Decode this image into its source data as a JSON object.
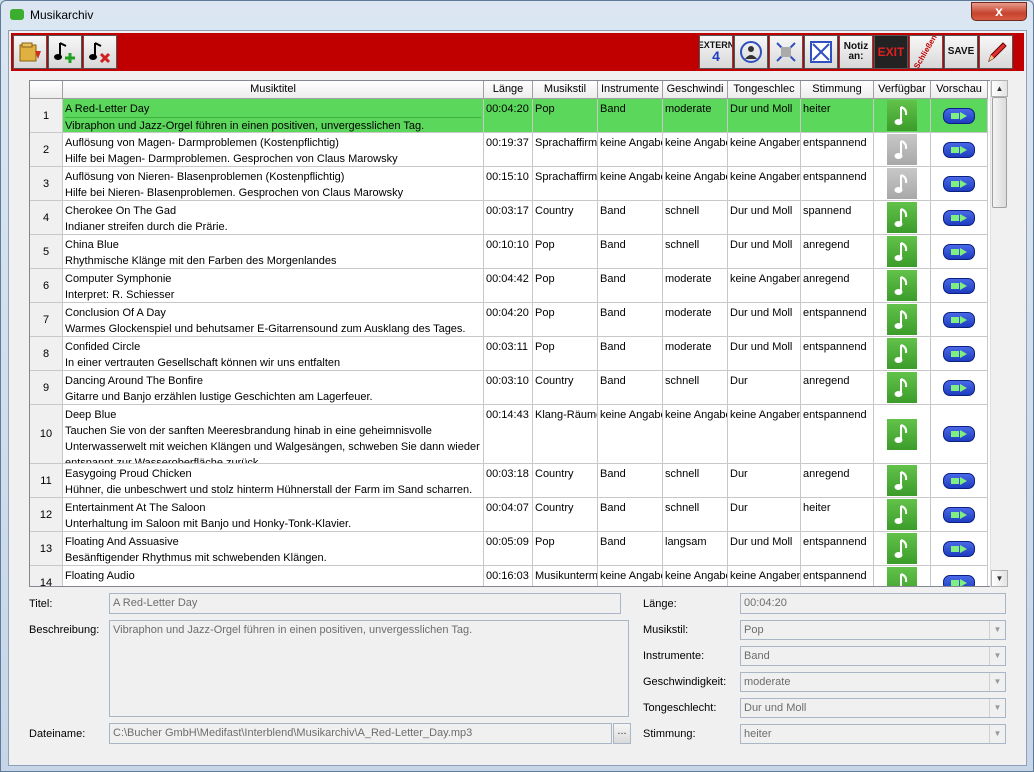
{
  "window": {
    "title": "Musikarchiv",
    "close_glyph": "x"
  },
  "toolbar": {
    "extern_label": "EXTERN",
    "extern_num": "4",
    "notiz_label": "Notiz",
    "notiz_label2": "an:",
    "exit_label": "EXIT",
    "schliessen_label": "Schließen",
    "save_label": "SAVE"
  },
  "table": {
    "columns": [
      "Musiktitel",
      "Länge",
      "Musikstil",
      "Instrumente",
      "Geschwindi",
      "Tongeschlec",
      "Stimmung",
      "Verfügbar",
      "Vorschau"
    ],
    "rows": [
      {
        "num": "1",
        "title": "A Red-Letter Day",
        "desc": "Vibraphon und Jazz-Orgel führen in einen positiven, unvergesslichen Tag.",
        "length": "00:04:20",
        "style": "Pop",
        "instr": "Band",
        "speed": "moderate",
        "tone": "Dur und Moll",
        "mood": "heiter",
        "available": true,
        "selected": true
      },
      {
        "num": "2",
        "title": "Auflösung von Magen- Darmproblemen (Kostenpflichtig)",
        "desc": "Hilfe bei Magen- Darmproblemen. Gesprochen von Claus Marowsky",
        "length": "00:19:37",
        "style": "Sprachaffirma",
        "instr": "keine Angabe",
        "speed": "keine Angabe",
        "tone": "keine Angaben",
        "mood": "entspannend",
        "available": false
      },
      {
        "num": "3",
        "title": "Auflösung von Nieren- Blasenproblemen (Kostenpflichtig)",
        "desc": "Hilfe bei Nieren- Blasenproblemen. Gesprochen von Claus Marowsky",
        "length": "00:15:10",
        "style": "Sprachaffirma",
        "instr": "keine Angabe",
        "speed": "keine Angabe",
        "tone": "keine Angaben",
        "mood": "entspannend",
        "available": false
      },
      {
        "num": "4",
        "title": "Cherokee On The Gad",
        "desc": "Indianer streifen durch die Prärie.",
        "length": "00:03:17",
        "style": "Country",
        "instr": "Band",
        "speed": "schnell",
        "tone": "Dur und Moll",
        "mood": "spannend",
        "available": true
      },
      {
        "num": "5",
        "title": "China Blue",
        "desc": "Rhythmische Klänge mit den Farben des Morgenlandes",
        "length": "00:10:10",
        "style": "Pop",
        "instr": "Band",
        "speed": "schnell",
        "tone": "Dur und Moll",
        "mood": "anregend",
        "available": true
      },
      {
        "num": "6",
        "title": "Computer Symphonie",
        "desc": "Interpret: R. Schiesser",
        "length": "00:04:42",
        "style": "Pop",
        "instr": "Band",
        "speed": "moderate",
        "tone": "keine Angaben",
        "mood": "anregend",
        "available": true
      },
      {
        "num": "7",
        "title": "Conclusion Of A Day",
        "desc": "Warmes Glockenspiel und behutsamer E-Gitarrensound zum Ausklang des Tages.",
        "length": "00:04:20",
        "style": "Pop",
        "instr": "Band",
        "speed": "moderate",
        "tone": "Dur und Moll",
        "mood": "entspannend",
        "available": true
      },
      {
        "num": "8",
        "title": "Confided Circle",
        "desc": "In einer vertrauten Gesellschaft können wir uns entfalten",
        "length": "00:03:11",
        "style": "Pop",
        "instr": "Band",
        "speed": "moderate",
        "tone": "Dur und Moll",
        "mood": "entspannend",
        "available": true
      },
      {
        "num": "9",
        "title": "Dancing Around The Bonfire",
        "desc": "Gitarre und Banjo erzählen lustige Geschichten am Lagerfeuer.",
        "length": "00:03:10",
        "style": "Country",
        "instr": "Band",
        "speed": "schnell",
        "tone": "Dur",
        "mood": "anregend",
        "available": true
      },
      {
        "num": "10",
        "title": "Deep Blue",
        "desc": "Tauchen Sie von der sanften Meeresbrandung hinab in eine geheimnisvolle Unterwasserwelt mit weichen Klängen und Walgesängen, schweben Sie dann wieder entspannt zur Wasseroberfläche zurück",
        "length": "00:14:43",
        "style": "Klang-Räume",
        "instr": "keine Angabe",
        "speed": "keine Angabe",
        "tone": "keine Angaben",
        "mood": "entspannend",
        "available": true,
        "tall": true
      },
      {
        "num": "11",
        "title": "Easygoing Proud Chicken",
        "desc": "Hühner, die unbeschwert und stolz hinterm Hühnerstall der Farm im Sand scharren.",
        "length": "00:03:18",
        "style": "Country",
        "instr": "Band",
        "speed": "schnell",
        "tone": "Dur",
        "mood": "anregend",
        "available": true
      },
      {
        "num": "12",
        "title": "Entertainment At The Saloon",
        "desc": "Unterhaltung im Saloon mit Banjo und Honky-Tonk-Klavier.",
        "length": "00:04:07",
        "style": "Country",
        "instr": "Band",
        "speed": "schnell",
        "tone": "Dur",
        "mood": "heiter",
        "available": true
      },
      {
        "num": "13",
        "title": "Floating And Assuasive",
        "desc": "Besänftigender Rhythmus mit schwebenden Klängen.",
        "length": "00:05:09",
        "style": "Pop",
        "instr": "Band",
        "speed": "langsam",
        "tone": "Dur und Moll",
        "mood": "entspannend",
        "available": true
      },
      {
        "num": "14",
        "title": "Floating Audio",
        "desc": "",
        "length": "00:16:03",
        "style": "Musikunterma",
        "instr": "keine Angabe",
        "speed": "keine Angabe",
        "tone": "keine Angaben",
        "mood": "entspannend",
        "available": true
      }
    ]
  },
  "detail": {
    "titel_label": "Titel:",
    "titel_value": "A Red-Letter Day",
    "beschreibung_label": "Beschreibung:",
    "beschreibung_value": "Vibraphon und Jazz-Orgel führen in einen positiven, unvergesslichen Tag.",
    "dateiname_label": "Dateiname:",
    "dateiname_value": "C:\\Bucher GmbH\\Medifast\\Interblend\\Musikarchiv\\A_Red-Letter_Day.mp3",
    "browse_label": "...",
    "laenge_label": "Länge:",
    "laenge_value": "00:04:20",
    "musikstil_label": "Musikstil:",
    "musikstil_value": "Pop",
    "instrumente_label": "Instrumente:",
    "instrumente_value": "Band",
    "geschwindigkeit_label": "Geschwindigkeit:",
    "geschwindigkeit_value": "moderate",
    "tongeschlecht_label": "Tongeschlecht:",
    "tongeschlecht_value": "Dur und Moll",
    "stimmung_label": "Stimmung:",
    "stimmung_value": "heiter"
  },
  "colors": {
    "toolbar": "#c00000",
    "selected_row": "#5bd85b",
    "available": "#3b9c2a",
    "unavailable": "#a8a8a8",
    "preview": "#1d3cc0"
  }
}
